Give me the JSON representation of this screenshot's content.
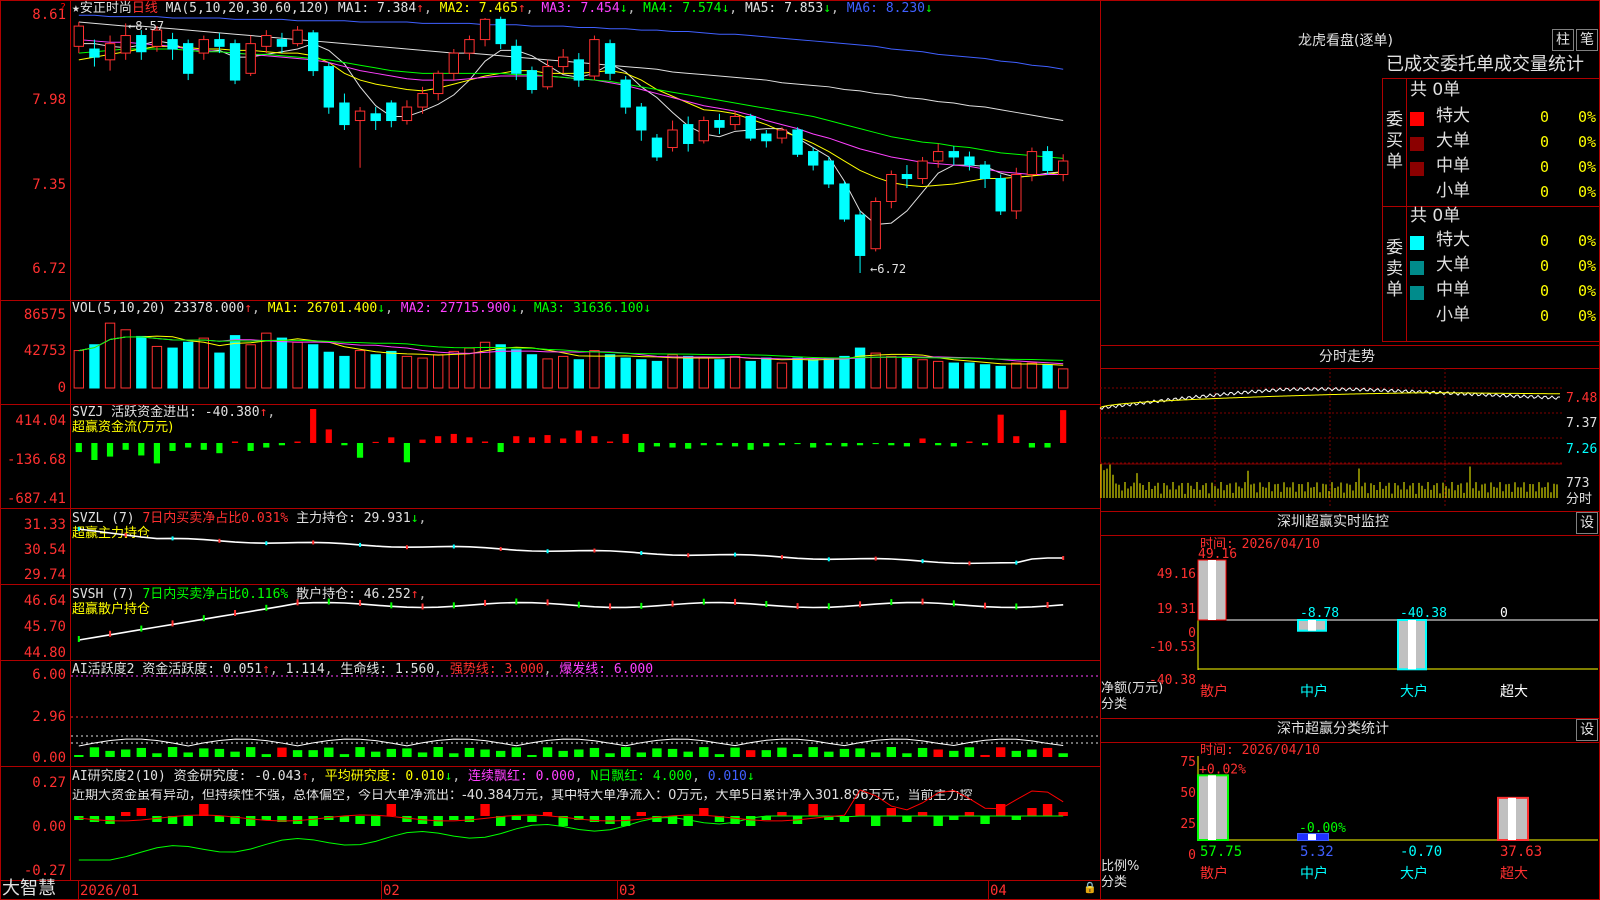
{
  "main": {
    "title": "★安正时尚",
    "period": "日线",
    "ma_label": "MA(5,10,20,30,60,120)",
    "ma_values": [
      {
        "label": "MA1: 7.384",
        "arrow": "↑",
        "color": "#e0e0e0"
      },
      {
        "label": "MA2: 7.465",
        "arrow": "↑",
        "color": "#ffff00"
      },
      {
        "label": "MA3: 7.454",
        "arrow": "↓",
        "color": "#ff40ff"
      },
      {
        "label": "MA4: 7.574",
        "arrow": "↓",
        "color": "#00ff00"
      },
      {
        "label": "MA5: 7.853",
        "arrow": "↓",
        "color": "#e0e0e0"
      },
      {
        "label": "MA6: 8.230",
        "arrow": "↓",
        "color": "#4060ff"
      }
    ],
    "high_note": "8.57",
    "low_note": "6.72",
    "yaxis": [
      "8.61",
      "7.98",
      "7.35",
      "6.72"
    ]
  },
  "vol": {
    "header": "VOL(5,10,20)",
    "value": "23378.000",
    "ma1": "MA1: 26701.400",
    "ma2": "MA2: 27715.900",
    "ma3": "MA3: 31636.100",
    "yaxis": [
      "86575",
      "42753",
      "0"
    ]
  },
  "svzj": {
    "header": "SVZJ  活跃资金进出: -40.380",
    "subtitle": "超赢资金流(万元)",
    "yaxis": [
      "414.04",
      "-136.68",
      "-687.41"
    ]
  },
  "svzl": {
    "header": "SVZL (7)",
    "ratio": "7日内买卖净占比0.031%",
    "hold": "主力持仓: 29.931",
    "subtitle": "超赢主力持仓",
    "yaxis": [
      "31.33",
      "30.54",
      "29.74"
    ]
  },
  "svsh": {
    "header": "SVSH (7)",
    "ratio": "7日内买卖净占比0.116%",
    "hold": "散户持仓: 46.252",
    "subtitle": "超赢散户持仓",
    "yaxis": [
      "46.64",
      "45.70",
      "44.80"
    ]
  },
  "ai1": {
    "header": "AI活跃度2 资金活跃度: 0.051",
    "v2": "1.114",
    "life": "生命线: 1.560",
    "strong": "强势线: 3.000",
    "burst": "爆发线: 6.000",
    "yaxis": [
      "6.00",
      "2.96",
      "0.00"
    ]
  },
  "ai2": {
    "header": "AI研究度2(10) 资金研究度: -0.043",
    "avg": "平均研究度: 0.010",
    "streak": "连续飘红: 0.000",
    "nday": "N日飘红: 4.000",
    "tail": "0.010",
    "comment": "近期大资金虽有异动，但持续性不强，总体偏空，今日大单净流出：-40.384万元，其中特大单净流入：0万元，大单5日累计净入301.896万元，当前主力控",
    "yaxis": [
      "0.27",
      "0.00",
      "-0.27"
    ]
  },
  "dates": [
    "2026/01",
    "02",
    "03",
    "04"
  ],
  "brand": "大智慧",
  "right": {
    "lh_title": "龙虎看盘(逐单)",
    "btn_bar": "柱",
    "btn_pen": "笔",
    "tabs": "已成交委托单成交量统计",
    "buy_label": "委买单",
    "sell_label": "委卖单",
    "buy_total": "共 0单",
    "sell_total": "共 0单",
    "buy_rows": [
      {
        "name": "特大",
        "n": "0",
        "p": "0%",
        "color": "#ff0000"
      },
      {
        "name": "大单",
        "n": "0",
        "p": "0%",
        "color": "#8b0000"
      },
      {
        "name": "中单",
        "n": "0",
        "p": "0%",
        "color": "#8b0000"
      },
      {
        "name": "小单",
        "n": "0",
        "p": "0%",
        "color": ""
      }
    ],
    "sell_rows": [
      {
        "name": "特大",
        "n": "0",
        "p": "0%",
        "color": "#00ffff"
      },
      {
        "name": "大单",
        "n": "0",
        "p": "0%",
        "color": "#008b8b"
      },
      {
        "name": "中单",
        "n": "0",
        "p": "0%",
        "color": "#008b8b"
      },
      {
        "name": "小单",
        "n": "0",
        "p": "0%",
        "color": ""
      }
    ],
    "intraday_title": "分时走势",
    "intraday_yaxis": [
      "7.48",
      "7.37",
      "7.26"
    ],
    "intraday_vol": "773",
    "intraday_unit": "分时",
    "sz_monitor_title": "深圳超赢实时监控",
    "settings": "设",
    "time_label": "时间: 2026/04/10",
    "monitor_yaxis": [
      "49.16",
      "19.31",
      "0",
      "-10.53",
      "-40.38"
    ],
    "monitor_unit": "净额(万元)",
    "monitor_unit2": "分类",
    "monitor_bars": [
      {
        "cat": "散户",
        "value": 49.16,
        "label": "49.16"
      },
      {
        "cat": "中户",
        "value": -8.78,
        "label": "-8.78"
      },
      {
        "cat": "大户",
        "value": -40.38,
        "label": "-40.38"
      },
      {
        "cat": "超大",
        "value": 0,
        "label": "0"
      }
    ],
    "sz_class_title": "深市超赢分类统计",
    "class_yaxis": [
      "75",
      "50",
      "25",
      "0"
    ],
    "class_unit": "比例%",
    "class_unit2": "分类",
    "class_bars": [
      {
        "cat": "散户",
        "value": 57.75,
        "top": "+0.02%",
        "bottom": "57.75"
      },
      {
        "cat": "中户",
        "value": 5.32,
        "top": "-0.00%",
        "bottom": "5.32"
      },
      {
        "cat": "大户",
        "value": 0,
        "top": "",
        "bottom": "-0.70"
      },
      {
        "cat": "超大",
        "value": 37.63,
        "top": "",
        "bottom": "37.63"
      }
    ]
  },
  "chart_data": {
    "type": "candlestick",
    "ylim": [
      6.72,
      8.61
    ],
    "candles": [
      [
        8.4,
        8.55,
        8.35,
        8.58
      ],
      [
        8.38,
        8.32,
        8.25,
        8.45
      ],
      [
        8.3,
        8.42,
        8.22,
        8.48
      ],
      [
        8.35,
        8.48,
        8.3,
        8.57
      ],
      [
        8.48,
        8.36,
        8.3,
        8.52
      ],
      [
        8.4,
        8.52,
        8.36,
        8.55
      ],
      [
        8.45,
        8.38,
        8.3,
        8.5
      ],
      [
        8.42,
        8.2,
        8.15,
        8.45
      ],
      [
        8.35,
        8.45,
        8.3,
        8.48
      ],
      [
        8.45,
        8.4,
        8.35,
        8.5
      ],
      [
        8.42,
        8.15,
        8.12,
        8.45
      ],
      [
        8.2,
        8.42,
        8.18,
        8.48
      ],
      [
        8.4,
        8.48,
        8.35,
        8.52
      ],
      [
        8.45,
        8.4,
        8.35,
        8.5
      ],
      [
        8.42,
        8.52,
        8.4,
        8.55
      ],
      [
        8.5,
        8.22,
        8.18,
        8.52
      ],
      [
        8.25,
        7.95,
        7.9,
        8.28
      ],
      [
        7.98,
        7.82,
        7.78,
        8.05
      ],
      [
        7.85,
        7.92,
        7.5,
        7.95
      ],
      [
        7.9,
        7.85,
        7.78,
        7.95
      ],
      [
        7.98,
        7.85,
        7.8,
        8.0
      ],
      [
        7.85,
        7.95,
        7.82,
        8.0
      ],
      [
        7.95,
        8.05,
        7.9,
        8.1
      ],
      [
        8.05,
        8.2,
        8.0,
        8.22
      ],
      [
        8.2,
        8.35,
        8.15,
        8.38
      ],
      [
        8.35,
        8.45,
        8.3,
        8.48
      ],
      [
        8.45,
        8.6,
        8.4,
        8.61
      ],
      [
        8.6,
        8.42,
        8.38,
        8.62
      ],
      [
        8.4,
        8.2,
        8.15,
        8.45
      ],
      [
        8.22,
        8.08,
        8.05,
        8.25
      ],
      [
        8.1,
        8.25,
        8.08,
        8.3
      ],
      [
        8.25,
        8.32,
        8.2,
        8.38
      ],
      [
        8.3,
        8.15,
        8.1,
        8.35
      ],
      [
        8.18,
        8.45,
        8.15,
        8.48
      ],
      [
        8.42,
        8.2,
        8.15,
        8.45
      ],
      [
        8.15,
        7.95,
        7.9,
        8.18
      ],
      [
        7.95,
        7.78,
        7.7,
        7.98
      ],
      [
        7.72,
        7.58,
        7.55,
        7.75
      ],
      [
        7.65,
        7.78,
        7.62,
        7.85
      ],
      [
        7.82,
        7.68,
        7.62,
        7.88
      ],
      [
        7.7,
        7.85,
        7.68,
        7.88
      ],
      [
        7.85,
        7.8,
        7.75,
        7.9
      ],
      [
        7.82,
        7.88,
        7.78,
        7.92
      ],
      [
        7.88,
        7.72,
        7.7,
        7.9
      ],
      [
        7.75,
        7.7,
        7.65,
        7.78
      ],
      [
        7.72,
        7.78,
        7.68,
        7.8
      ],
      [
        7.78,
        7.6,
        7.58,
        7.8
      ],
      [
        7.62,
        7.52,
        7.48,
        7.65
      ],
      [
        7.55,
        7.38,
        7.35,
        7.58
      ],
      [
        7.38,
        7.12,
        7.1,
        7.4
      ],
      [
        7.15,
        6.85,
        6.72,
        7.18
      ],
      [
        6.9,
        7.25,
        6.88,
        7.28
      ],
      [
        7.25,
        7.45,
        7.2,
        7.48
      ],
      [
        7.45,
        7.42,
        7.35,
        7.52
      ],
      [
        7.42,
        7.55,
        7.38,
        7.58
      ],
      [
        7.55,
        7.62,
        7.5,
        7.68
      ],
      [
        7.62,
        7.58,
        7.52,
        7.66
      ],
      [
        7.58,
        7.52,
        7.48,
        7.62
      ],
      [
        7.52,
        7.42,
        7.35,
        7.55
      ],
      [
        7.42,
        7.18,
        7.15,
        7.45
      ],
      [
        7.18,
        7.45,
        7.12,
        7.5
      ],
      [
        7.45,
        7.62,
        7.4,
        7.65
      ],
      [
        7.62,
        7.48,
        7.45,
        7.66
      ],
      [
        7.45,
        7.55,
        7.4,
        7.6
      ]
    ],
    "ma_lines": [
      {
        "name": "MA1",
        "color": "#e0e0e0",
        "values": [
          8.42,
          8.42,
          8.4,
          8.39,
          8.41,
          8.44,
          8.42,
          8.37,
          8.36,
          8.37,
          8.32,
          8.32,
          8.34,
          8.36,
          8.38,
          8.42,
          8.37,
          8.27,
          8.1,
          7.96,
          7.88,
          7.88,
          7.92,
          7.97,
          8.04,
          8.15,
          8.29,
          8.37,
          8.37,
          8.33,
          8.26,
          8.19,
          8.17,
          8.2,
          8.27,
          8.21,
          8.1,
          8.02,
          7.91,
          7.81,
          7.75,
          7.73,
          7.77,
          7.78,
          7.79,
          7.79,
          7.72,
          7.65,
          7.58,
          7.4,
          7.18,
          7.08,
          7.09,
          7.18,
          7.32,
          7.46,
          7.52,
          7.52,
          7.51,
          7.46,
          7.43,
          7.44,
          7.46,
          7.47
        ]
      },
      {
        "name": "MA2",
        "color": "#ffff00",
        "values": [
          8.3,
          8.32,
          8.34,
          8.36,
          8.38,
          8.4,
          8.4,
          8.39,
          8.38,
          8.38,
          8.37,
          8.37,
          8.36,
          8.35,
          8.35,
          8.33,
          8.28,
          8.2,
          8.15,
          8.12,
          8.1,
          8.08,
          8.07,
          8.09,
          8.12,
          8.15,
          8.18,
          8.2,
          8.22,
          8.22,
          8.2,
          8.2,
          8.2,
          8.21,
          8.22,
          8.2,
          8.15,
          8.08,
          8.03,
          7.98,
          7.93,
          7.92,
          7.9,
          7.86,
          7.82,
          7.77,
          7.73,
          7.68,
          7.62,
          7.55,
          7.48,
          7.43,
          7.39,
          7.37,
          7.36,
          7.37,
          7.38,
          7.4,
          7.42,
          7.42,
          7.43,
          7.44,
          7.45,
          7.47
        ]
      },
      {
        "name": "MA3",
        "color": "#ff40ff",
        "values": [
          8.45,
          8.44,
          8.43,
          8.43,
          8.42,
          8.41,
          8.4,
          8.38,
          8.37,
          8.36,
          8.35,
          8.34,
          8.33,
          8.32,
          8.31,
          8.3,
          8.28,
          8.25,
          8.22,
          8.2,
          8.18,
          8.16,
          8.15,
          8.15,
          8.15,
          8.16,
          8.17,
          8.18,
          8.18,
          8.18,
          8.18,
          8.17,
          8.16,
          8.15,
          8.13,
          8.11,
          8.08,
          8.05,
          8.02,
          7.99,
          7.96,
          7.94,
          7.92,
          7.89,
          7.85,
          7.82,
          7.79,
          7.75,
          7.72,
          7.68,
          7.64,
          7.61,
          7.58,
          7.56,
          7.54,
          7.53,
          7.52,
          7.51,
          7.49,
          7.47,
          7.46,
          7.45,
          7.45,
          7.45
        ]
      },
      {
        "name": "MA4",
        "color": "#00ff00",
        "values": [
          8.35,
          8.36,
          8.37,
          8.38,
          8.38,
          8.38,
          8.38,
          8.37,
          8.36,
          8.36,
          8.35,
          8.34,
          8.34,
          8.33,
          8.32,
          8.31,
          8.3,
          8.28,
          8.26,
          8.24,
          8.22,
          8.21,
          8.2,
          8.2,
          8.2,
          8.2,
          8.2,
          8.2,
          8.19,
          8.19,
          8.18,
          8.17,
          8.16,
          8.15,
          8.14,
          8.12,
          8.1,
          8.08,
          8.06,
          8.04,
          8.02,
          8.0,
          7.98,
          7.96,
          7.94,
          7.92,
          7.9,
          7.88,
          7.85,
          7.82,
          7.79,
          7.76,
          7.73,
          7.71,
          7.69,
          7.68,
          7.66,
          7.65,
          7.63,
          7.61,
          7.6,
          7.59,
          7.58,
          7.57
        ]
      },
      {
        "name": "MA5",
        "color": "#e0e0e0",
        "values": [
          8.58,
          8.57,
          8.56,
          8.55,
          8.55,
          8.54,
          8.53,
          8.52,
          8.51,
          8.5,
          8.49,
          8.48,
          8.47,
          8.46,
          8.45,
          8.44,
          8.43,
          8.42,
          8.41,
          8.4,
          8.39,
          8.38,
          8.37,
          8.36,
          8.35,
          8.35,
          8.34,
          8.33,
          8.32,
          8.31,
          8.3,
          8.29,
          8.28,
          8.27,
          8.26,
          8.25,
          8.24,
          8.23,
          8.21,
          8.2,
          8.19,
          8.18,
          8.17,
          8.16,
          8.15,
          8.13,
          8.12,
          8.11,
          8.1,
          8.08,
          8.07,
          8.05,
          8.04,
          8.02,
          8.01,
          7.99,
          7.98,
          7.96,
          7.95,
          7.93,
          7.91,
          7.89,
          7.87,
          7.85
        ]
      },
      {
        "name": "MA6",
        "color": "#4060ff",
        "values": [
          8.63,
          8.63,
          8.62,
          8.62,
          8.62,
          8.62,
          8.61,
          8.61,
          8.61,
          8.61,
          8.6,
          8.6,
          8.6,
          8.6,
          8.59,
          8.59,
          8.59,
          8.59,
          8.58,
          8.58,
          8.58,
          8.58,
          8.57,
          8.57,
          8.57,
          8.57,
          8.56,
          8.56,
          8.56,
          8.55,
          8.55,
          8.55,
          8.54,
          8.54,
          8.53,
          8.53,
          8.52,
          8.52,
          8.51,
          8.51,
          8.5,
          8.49,
          8.49,
          8.48,
          8.47,
          8.46,
          8.45,
          8.44,
          8.43,
          8.42,
          8.41,
          8.4,
          8.38,
          8.37,
          8.36,
          8.34,
          8.33,
          8.32,
          8.31,
          8.29,
          8.28,
          8.26,
          8.25,
          8.23
        ]
      }
    ],
    "volume": [
      45,
      52,
      78,
      70,
      62,
      50,
      48,
      55,
      60,
      42,
      63,
      52,
      66,
      60,
      55,
      52,
      43,
      38,
      45,
      40,
      44,
      38,
      36,
      40,
      44,
      48,
      55,
      52,
      46,
      40,
      35,
      38,
      34,
      45,
      40,
      36,
      34,
      32,
      40,
      38,
      36,
      34,
      38,
      32,
      36,
      30,
      36,
      34,
      36,
      38,
      48,
      42,
      38,
      36,
      34,
      32,
      30,
      30,
      28,
      26,
      30,
      30,
      28,
      23
    ],
    "svzj": [
      -80,
      -150,
      -120,
      -60,
      -110,
      -180,
      -70,
      -40,
      -60,
      -90,
      0,
      -70,
      -40,
      -20,
      0,
      300,
      120,
      -20,
      -130,
      10,
      50,
      -170,
      30,
      60,
      80,
      50,
      0,
      -80,
      60,
      50,
      70,
      40,
      110,
      60,
      0,
      80,
      -80,
      -30,
      -40,
      -50,
      -20,
      -20,
      -30,
      -60,
      -30,
      -20,
      -10,
      -40,
      -20,
      -30,
      -20,
      -10,
      -20,
      -30,
      40,
      -20,
      -30,
      0,
      -20,
      250,
      60,
      -40,
      -40,
      290,
      -40,
      -30
    ]
  }
}
